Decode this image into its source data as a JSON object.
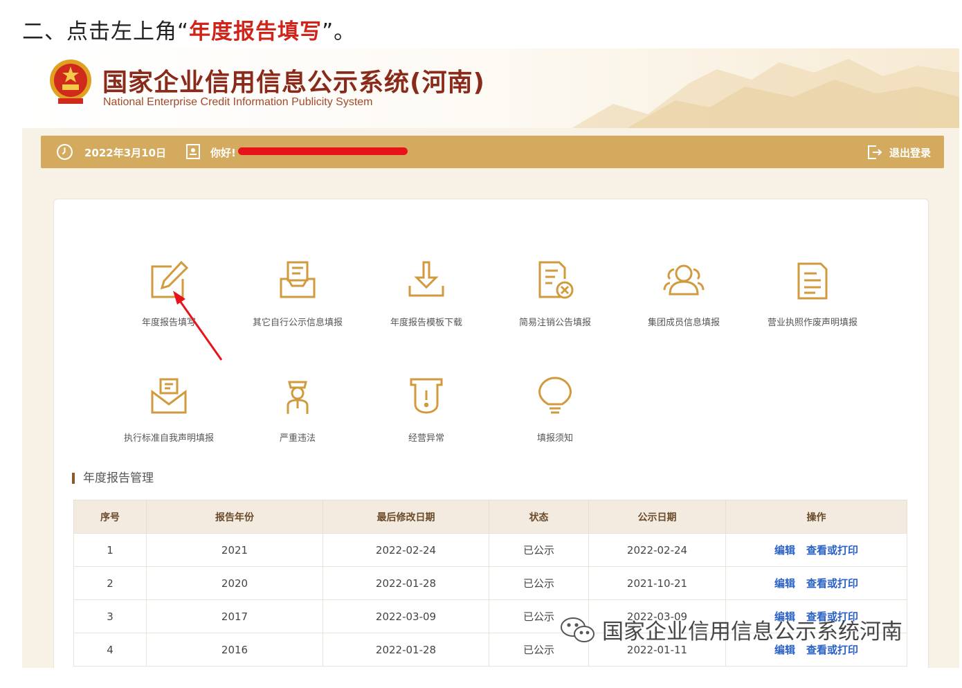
{
  "instruction": {
    "prefix": "二、点击左上角“",
    "highlight": "年度报告填写",
    "suffix": "”。"
  },
  "site": {
    "title": "国家企业信用信息公示系统(河南)",
    "subtitle": "National Enterprise Credit Information Publicity System"
  },
  "topbar": {
    "date": "2022年3月10日",
    "greeting": "你好!",
    "logout": "退出登录"
  },
  "menu": [
    {
      "label": "年度报告填写",
      "icon": "edit-report-icon"
    },
    {
      "label": "其它自行公示信息填报",
      "icon": "inbox-tray-icon"
    },
    {
      "label": "年度报告模板下载",
      "icon": "download-icon"
    },
    {
      "label": "简易注销公告填报",
      "icon": "document-cancel-icon"
    },
    {
      "label": "集团成员信息填报",
      "icon": "group-users-icon"
    },
    {
      "label": "营业执照作废声明填报",
      "icon": "document-list-icon"
    },
    {
      "label": "执行标准自我声明填报",
      "icon": "envelope-icon"
    },
    {
      "label": "严重违法",
      "icon": "police-officer-icon"
    },
    {
      "label": "经营异常",
      "icon": "alert-shield-icon"
    },
    {
      "label": "填报须知",
      "icon": "lightbulb-icon"
    }
  ],
  "section_title": "年度报告管理",
  "table": {
    "headers": [
      "序号",
      "报告年份",
      "最后修改日期",
      "状态",
      "公示日期",
      "操作"
    ],
    "rows": [
      {
        "no": "1",
        "year": "2021",
        "modified": "2022-02-24",
        "status": "已公示",
        "published": "2022-02-24",
        "edit": "编辑",
        "view": "查看或打印"
      },
      {
        "no": "2",
        "year": "2020",
        "modified": "2022-01-28",
        "status": "已公示",
        "published": "2021-10-21",
        "edit": "编辑",
        "view": "查看或打印"
      },
      {
        "no": "3",
        "year": "2017",
        "modified": "2022-03-09",
        "status": "已公示",
        "published": "2022-03-09",
        "edit": "编辑",
        "view": "查看或打印"
      },
      {
        "no": "4",
        "year": "2016",
        "modified": "2022-01-28",
        "status": "已公示",
        "published": "2022-01-11",
        "edit": "编辑",
        "view": "查看或打印"
      }
    ]
  },
  "watermark": "国家企业信用信息公示系统河南",
  "colors": {
    "accent_gold": "#d4ab5e",
    "icon_gold": "#d19a3d",
    "title_red": "#8a2a1a",
    "link_blue": "#2a61c9",
    "annotation_red": "#e8131a"
  }
}
